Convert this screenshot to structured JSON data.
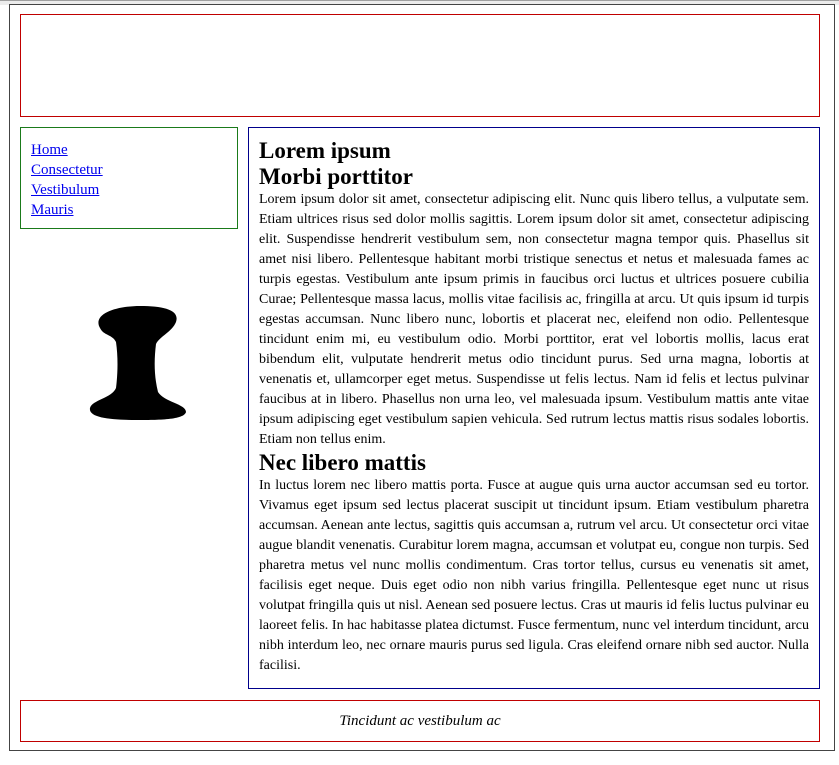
{
  "nav": {
    "links": [
      "Home",
      "Consectetur",
      "Vestibulum",
      "Mauris"
    ]
  },
  "logo": {
    "glyph": "I",
    "icon": "stylized-letter-i"
  },
  "content": {
    "title": "Lorem ipsum",
    "section1_heading": "Morbi porttitor",
    "section1_text": "Lorem ipsum dolor sit amet, consectetur adipiscing elit. Nunc quis libero tellus, a vulputate sem. Etiam ultrices risus sed dolor mollis sagittis. Lorem ipsum dolor sit amet, consectetur adipiscing elit. Suspendisse hendrerit vestibulum sem, non consectetur magna tempor quis. Phasellus sit amet nisi libero. Pellentesque habitant morbi tristique senectus et netus et malesuada fames ac turpis egestas. Vestibulum ante ipsum primis in faucibus orci luctus et ultrices posuere cubilia Curae; Pellentesque massa lacus, mollis vitae facilisis ac, fringilla at arcu. Ut quis ipsum id turpis egestas accumsan. Nunc libero nunc, lobortis et placerat nec, eleifend non odio. Pellentesque tincidunt enim mi, eu vestibulum odio. Morbi porttitor, erat vel lobortis mollis, lacus erat bibendum elit, vulputate hendrerit metus odio tincidunt purus. Sed urna magna, lobortis at venenatis et, ullamcorper eget metus. Suspendisse ut felis lectus. Nam id felis et lectus pulvinar faucibus at in libero. Phasellus non urna leo, vel malesuada ipsum. Vestibulum mattis ante vitae ipsum adipiscing eget vestibulum sapien vehicula. Sed rutrum lectus mattis risus sodales lobortis. Etiam non tellus enim.",
    "section2_heading": "Nec libero mattis",
    "section2_text": "In luctus lorem nec libero mattis porta. Fusce at augue quis urna auctor accumsan sed eu tortor. Vivamus eget ipsum sed lectus placerat suscipit ut tincidunt ipsum. Etiam vestibulum pharetra accumsan. Aenean ante lectus, sagittis quis accumsan a, rutrum vel arcu. Ut consectetur orci vitae augue blandit venenatis. Curabitur lorem magna, accumsan et volutpat eu, congue non turpis. Sed pharetra metus vel nunc mollis condimentum. Cras tortor tellus, cursus eu venenatis sit amet, facilisis eget neque. Duis eget odio non nibh varius fringilla. Pellentesque eget nunc ut risus volutpat fringilla quis ut nisl. Aenean sed posuere lectus. Cras ut mauris id felis luctus pulvinar eu laoreet felis. In hac habitasse platea dictumst. Fusce fermentum, nunc vel interdum tincidunt, arcu nibh interdum leo, nec ornare mauris purus sed ligula. Cras eleifend ornare nibh sed auctor. Nulla facilisi."
  },
  "footer": {
    "text": "Tincidunt ac vestibulum ac"
  },
  "colors": {
    "header_border": "#c00000",
    "nav_border": "#1a7a1a",
    "content_border": "#00008b",
    "footer_border": "#c00000",
    "link": "#0000ee"
  }
}
